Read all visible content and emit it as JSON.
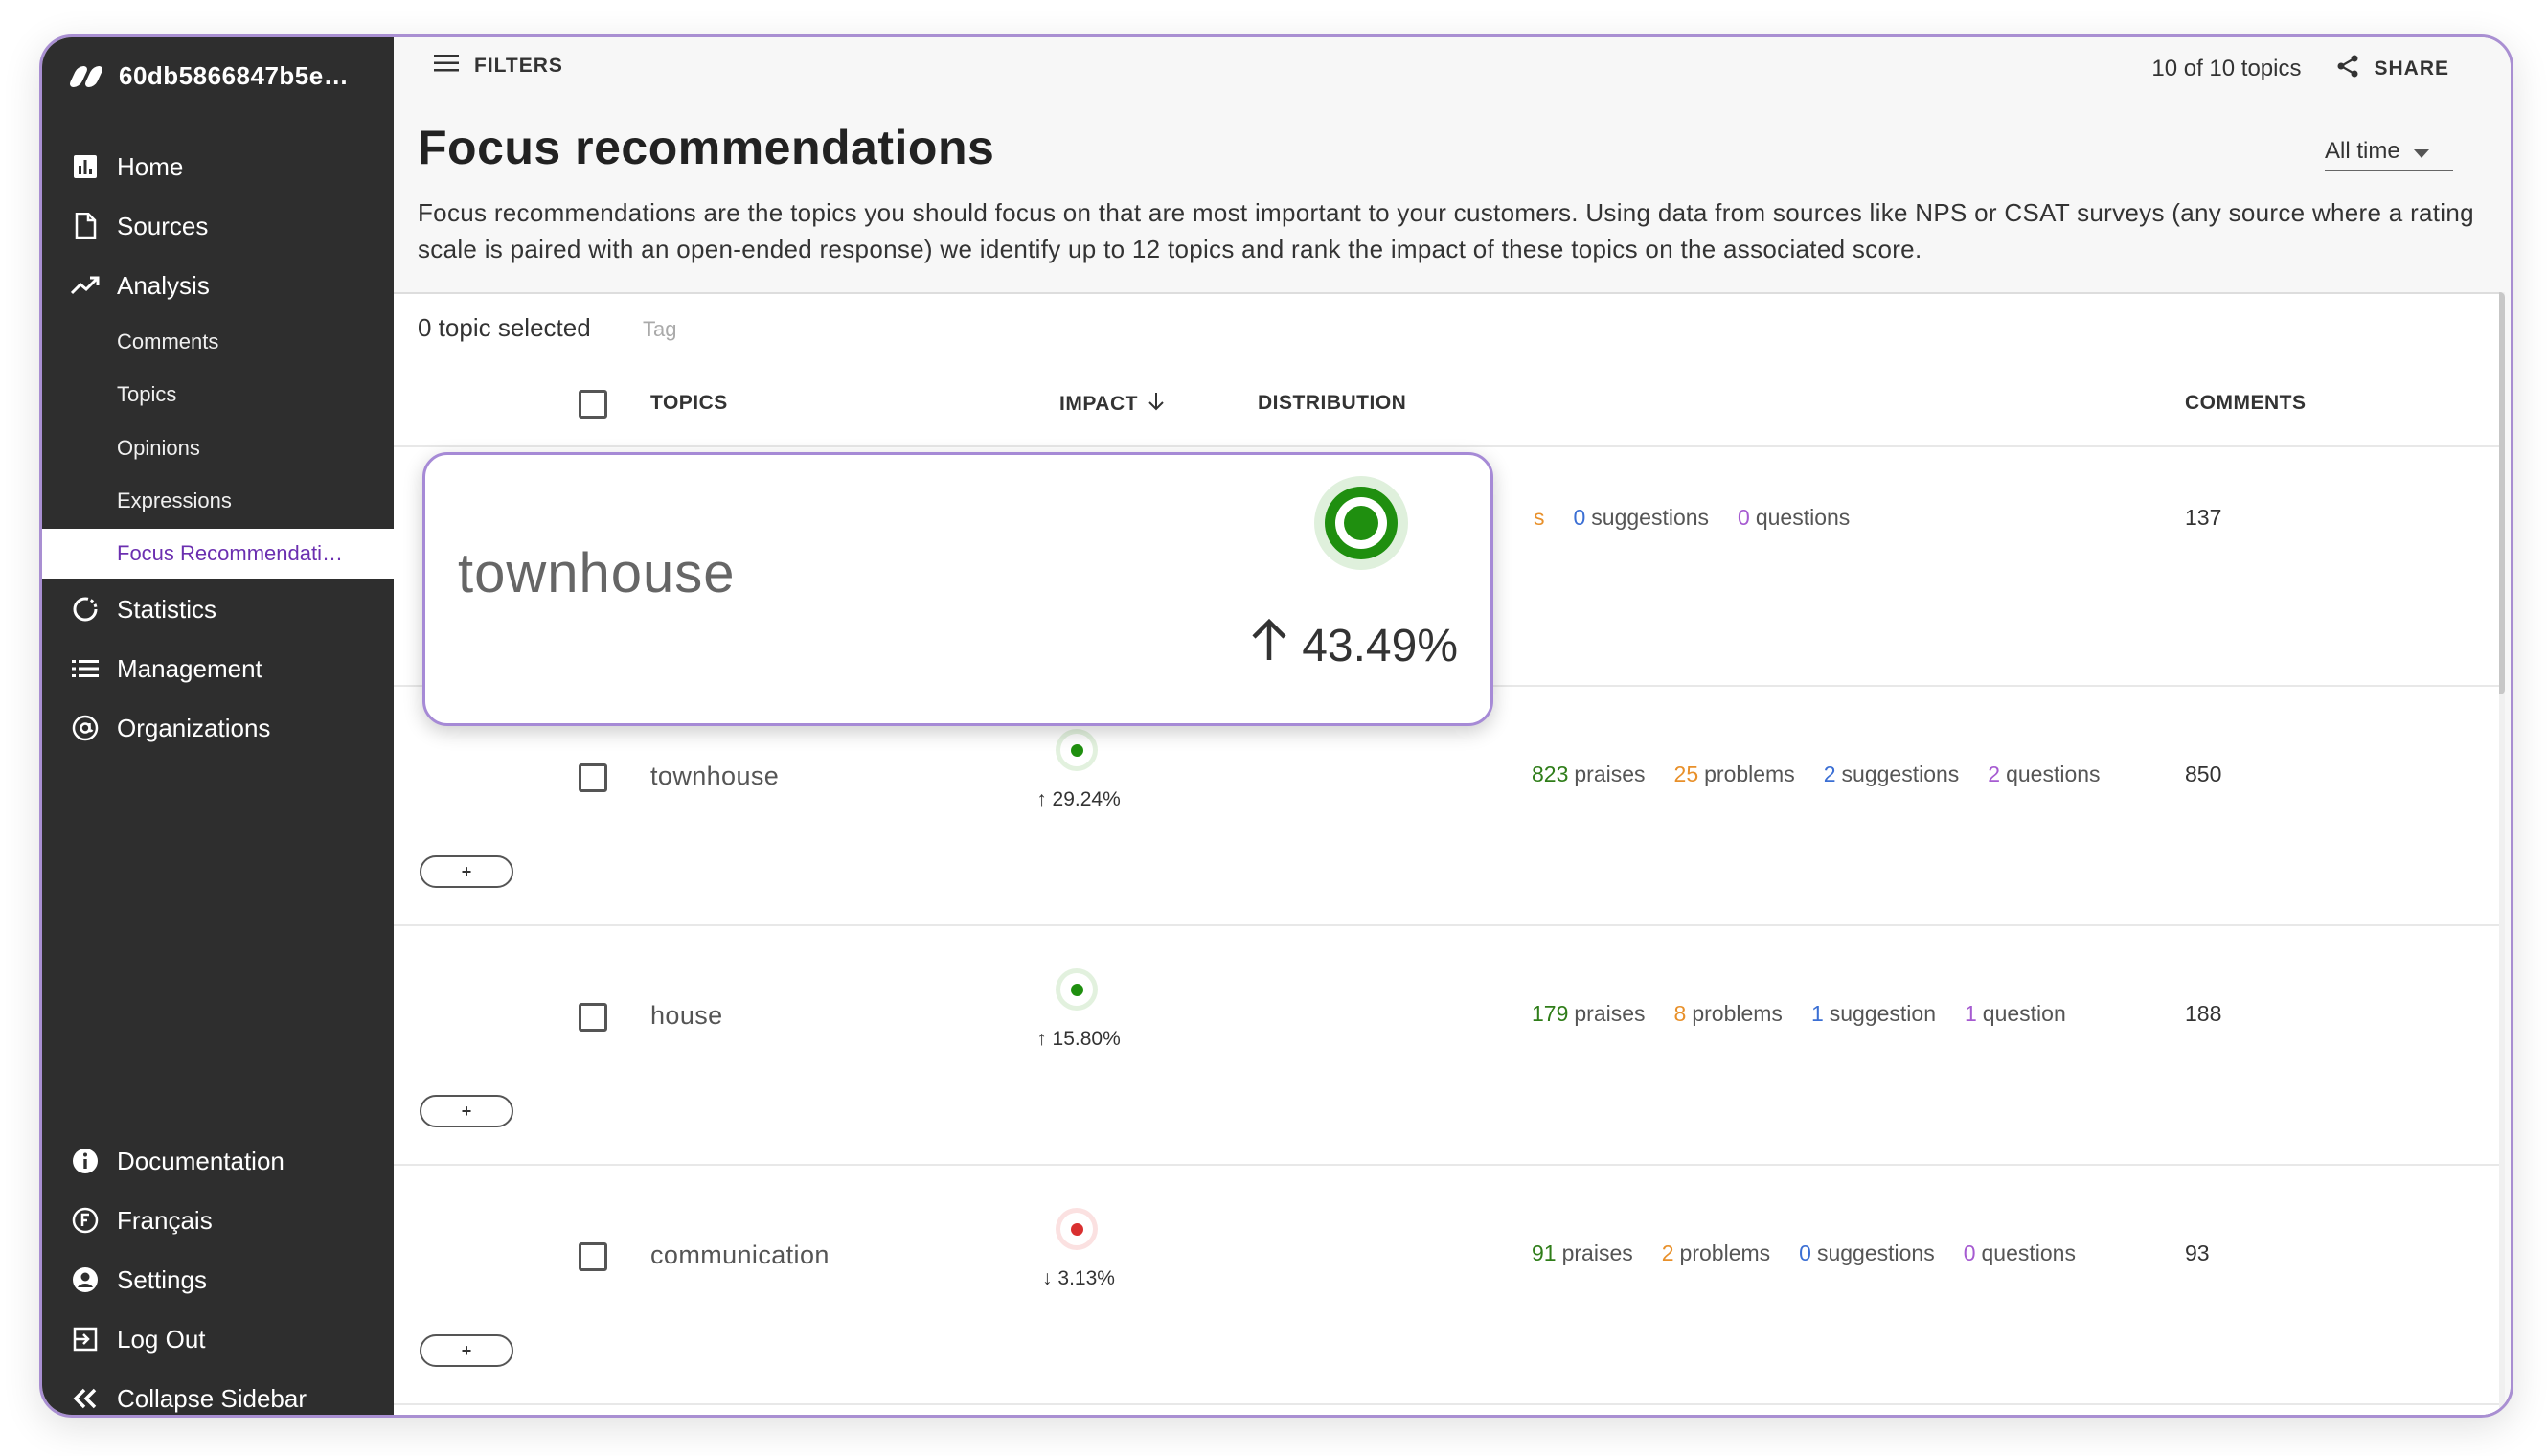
{
  "sidebar": {
    "brand": "60db5866847b5e…",
    "nav": [
      {
        "label": "Home",
        "icon": "bar-chart-icon"
      },
      {
        "label": "Sources",
        "icon": "document-icon"
      },
      {
        "label": "Analysis",
        "icon": "trend-icon"
      }
    ],
    "analysis_sub": [
      "Comments",
      "Topics",
      "Opinions",
      "Expressions",
      "Focus Recommendati…"
    ],
    "nav2": [
      {
        "label": "Statistics",
        "icon": "refresh-icon"
      },
      {
        "label": "Management",
        "icon": "list-icon"
      },
      {
        "label": "Organizations",
        "icon": "at-icon"
      }
    ],
    "bottom": [
      {
        "label": "Documentation",
        "icon": "info-icon"
      },
      {
        "label": "Français",
        "icon": "language-icon"
      },
      {
        "label": "Settings",
        "icon": "user-icon"
      },
      {
        "label": "Log Out",
        "icon": "logout-icon"
      },
      {
        "label": "Collapse Sidebar",
        "icon": "double-chevron-left-icon"
      }
    ]
  },
  "topbar": {
    "filters_label": "FILTERS",
    "topic_count": "10 of 10 topics",
    "share_label": "SHARE"
  },
  "page": {
    "title": "Focus recommendations",
    "time_filter": "All time",
    "description": "Focus recommendations are the topics you should focus on that are most important to your customers. Using data from sources like NPS or CSAT surveys (any source where a rating scale is paired with an open-ended response) we identify up to 12 topics and rank the impact of these topics on the associated score."
  },
  "table": {
    "selected_count": "0 topic selected",
    "tag_label": "Tag",
    "columns": {
      "topics": "TOPICS",
      "impact": "IMPACT",
      "distribution": "DISTRIBUTION",
      "comments": "COMMENTS"
    },
    "first_row_partial": {
      "problems_word": "s",
      "suggestions_n": "0",
      "suggestions_label": "suggestions",
      "questions_n": "0",
      "questions_label": "questions",
      "comments": "137"
    },
    "rows": [
      {
        "topic": "townhouse",
        "impact": "29.24%",
        "direction": "up",
        "dot_color": "#1f8f0f",
        "halo_color": "#e2f1de",
        "praises_n": "823",
        "praises": "praises",
        "problems_n": "25",
        "problems": "problems",
        "suggestions_n": "2",
        "suggestions": "suggestions",
        "questions_n": "2",
        "questions": "questions",
        "comments": "850"
      },
      {
        "topic": "house",
        "impact": "15.80%",
        "direction": "up",
        "dot_color": "#1f8f0f",
        "halo_color": "#e2f1de",
        "praises_n": "179",
        "praises": "praises",
        "problems_n": "8",
        "problems": "problems",
        "suggestions_n": "1",
        "suggestions": "suggestion",
        "questions_n": "1",
        "questions": "question",
        "comments": "188"
      },
      {
        "topic": "communication",
        "impact": "3.13%",
        "direction": "down",
        "dot_color": "#d93030",
        "halo_color": "#fbe1e1",
        "praises_n": "91",
        "praises": "praises",
        "problems_n": "2",
        "problems": "problems",
        "suggestions_n": "0",
        "suggestions": "suggestions",
        "questions_n": "0",
        "questions": "questions",
        "comments": "93"
      }
    ],
    "add_label": "+"
  },
  "tooltip": {
    "topic": "townhouse",
    "impact": "43.49%"
  }
}
